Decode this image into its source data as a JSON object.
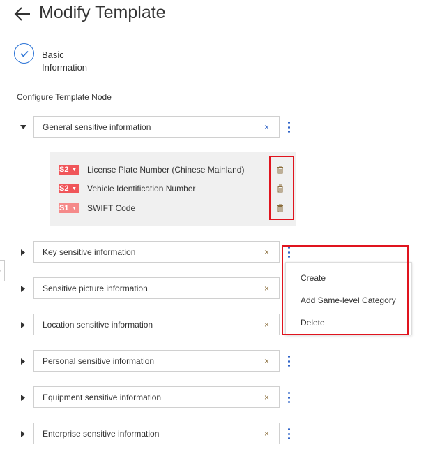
{
  "header": {
    "title": "Modify Template"
  },
  "steps": [
    {
      "label_line1": "Basic",
      "label_line2": "Information",
      "status": "completed"
    }
  ],
  "section_title": "Configure Template Node",
  "expanded_category": {
    "label": "General sensitive information",
    "clear": "×",
    "items": [
      {
        "level": "S2",
        "name": "License Plate Number (Chinese Mainland)",
        "color": "#f0565a"
      },
      {
        "level": "S2",
        "name": "Vehicle Identification Number",
        "color": "#f0565a"
      },
      {
        "level": "S1",
        "name": "SWIFT Code",
        "color": "#f58a8a"
      }
    ]
  },
  "categories": [
    {
      "label": "Key sensitive information",
      "clear": "×"
    },
    {
      "label": "Sensitive picture information",
      "clear": "×"
    },
    {
      "label": "Location sensitive information",
      "clear": "×"
    },
    {
      "label": "Personal sensitive information",
      "clear": "×"
    },
    {
      "label": "Equipment sensitive information",
      "clear": "×"
    },
    {
      "label": "Enterprise sensitive information",
      "clear": "×"
    }
  ],
  "context_menu": {
    "items": [
      "Create",
      "Add Same-level Category",
      "Delete"
    ]
  }
}
